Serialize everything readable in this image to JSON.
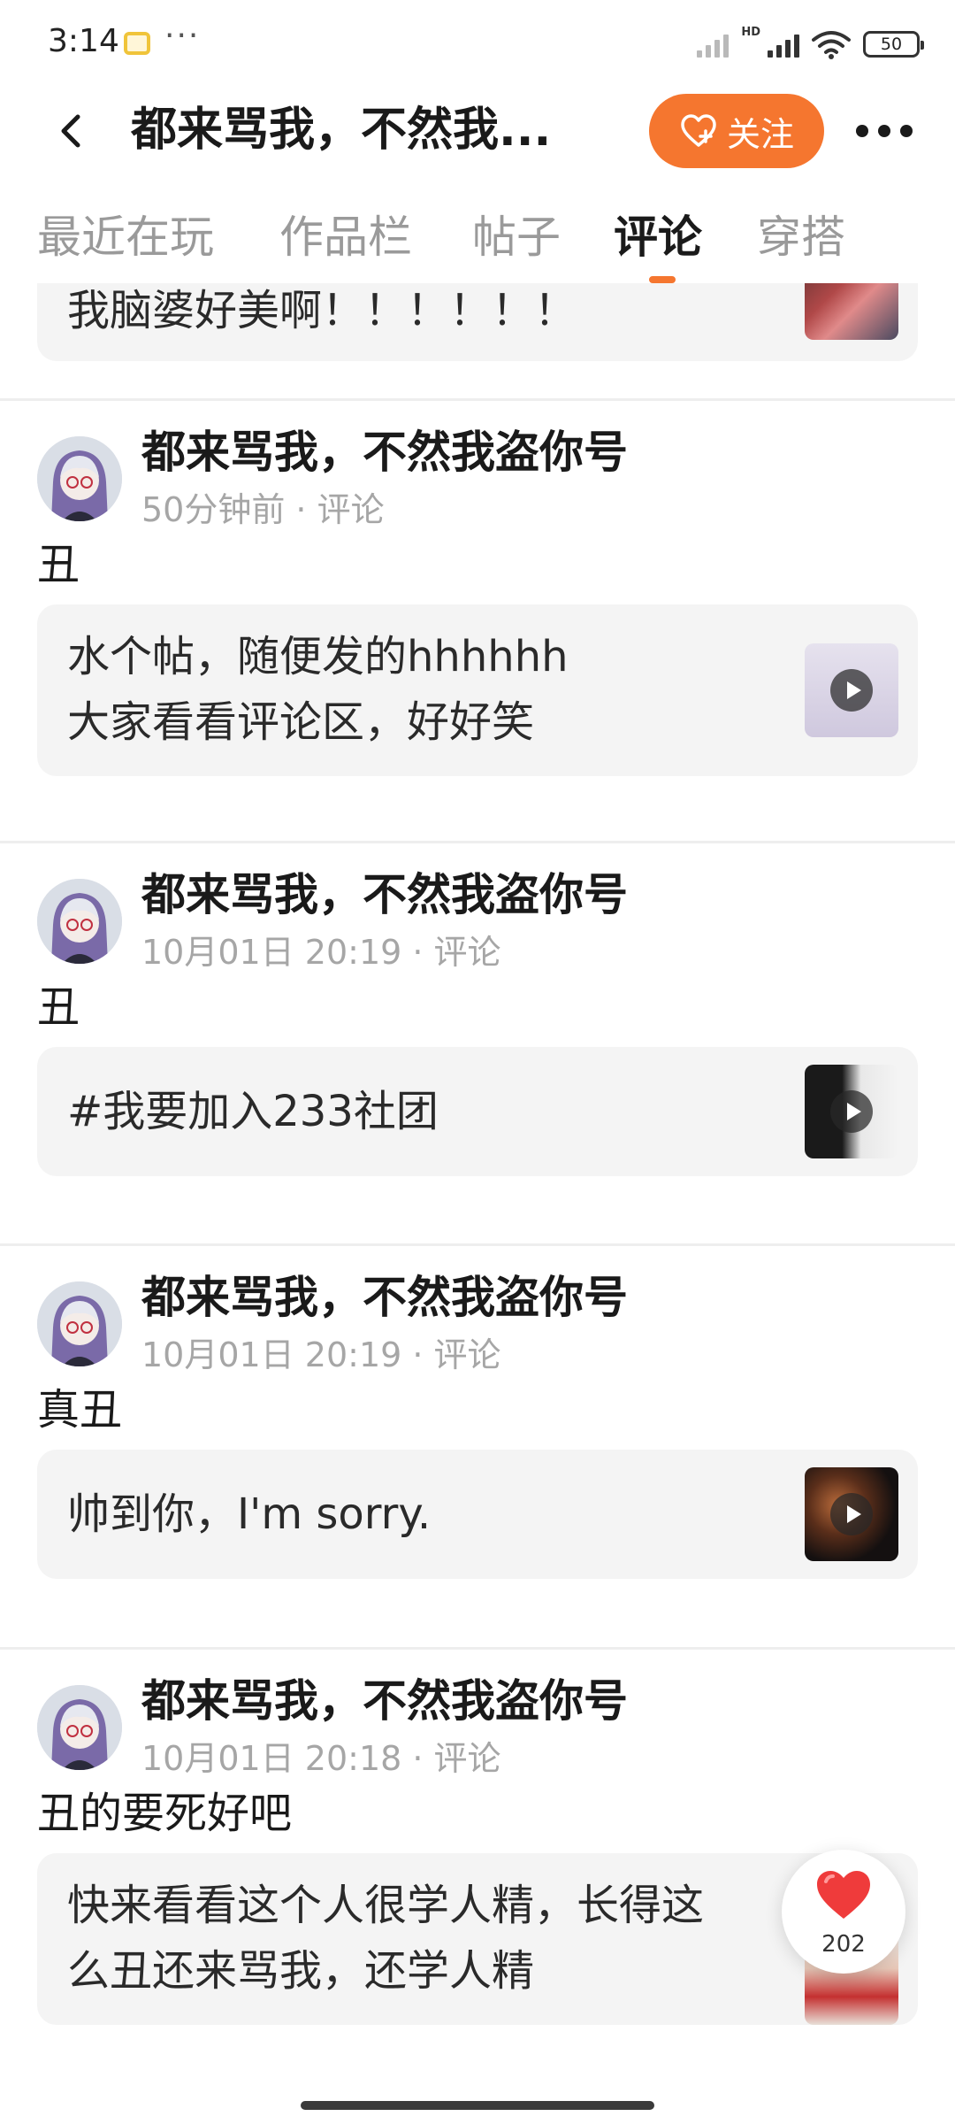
{
  "status_bar": {
    "time": "3:14",
    "more": "···",
    "hd": "HD",
    "battery": "50"
  },
  "header": {
    "title": "都来骂我，不然我...",
    "follow_label": "关注"
  },
  "tabs": [
    {
      "label": "最近在玩"
    },
    {
      "label": "作品栏"
    },
    {
      "label": "帖子"
    },
    {
      "label": "评论"
    },
    {
      "label": "穿搭"
    }
  ],
  "active_tab": "评论",
  "partial_card": {
    "text": "我脑婆好美啊！！！！！！"
  },
  "posts": [
    {
      "author": "都来骂我，不然我盗你号",
      "meta": "50分钟前 · 评论",
      "comment": "丑",
      "card_lines": [
        "水个帖，随便发的hhhhhh",
        "大家看看评论区，好好笑"
      ]
    },
    {
      "author": "都来骂我，不然我盗你号",
      "meta": "10月01日 20:19 · 评论",
      "comment": "丑",
      "card_lines": [
        "#我要加入233社团"
      ]
    },
    {
      "author": "都来骂我，不然我盗你号",
      "meta": "10月01日 20:19 · 评论",
      "comment": "真丑",
      "card_lines": [
        "帅到你，I'm sorry."
      ]
    },
    {
      "author": "都来骂我，不然我盗你号",
      "meta": "10月01日 20:18 · 评论",
      "comment": "丑的要死好吧",
      "card_lines": [
        "快来看看这个人很学人精，长得这",
        "么丑还来骂我，还学人精"
      ]
    }
  ],
  "like_fab": {
    "count": "202"
  },
  "colors": {
    "accent": "#f5762f",
    "like": "#ef3b3b",
    "card_bg": "#f4f4f4"
  }
}
